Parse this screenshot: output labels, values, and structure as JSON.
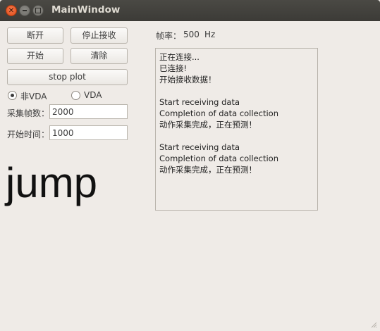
{
  "window": {
    "title": "MainWindow"
  },
  "buttons": {
    "disconnect": "断开",
    "stop_receive": "停止接收",
    "start": "开始",
    "clear": "清除",
    "stop_plot": "stop plot"
  },
  "radios": {
    "non_vda": {
      "label": "非VDA",
      "checked": true
    },
    "vda": {
      "label": "VDA",
      "checked": false
    }
  },
  "fields": {
    "frame_count": {
      "label": "采集帧数：",
      "value": "2000"
    },
    "start_time": {
      "label": "开始时间：",
      "value": "1000"
    }
  },
  "frame_rate": {
    "label": "帧率：",
    "value": "500",
    "unit": "Hz"
  },
  "status_text": "jump",
  "log": [
    "正在连接...",
    "已连接!",
    "开始接收数据！",
    "",
    "Start receiving data",
    "Completion of data collection",
    "动作采集完成，正在预测！",
    "",
    "Start receiving data",
    "Completion of data collection",
    "动作采集完成，正在预测！"
  ],
  "icons": {
    "close": "close-icon",
    "minimize": "minimize-icon",
    "maximize": "maximize-icon"
  },
  "colors": {
    "titlebar": "#3c3b37",
    "window_bg": "#efebe7",
    "close_button": "#df4a16"
  }
}
